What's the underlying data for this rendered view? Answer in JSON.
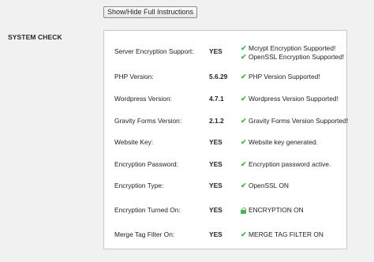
{
  "toggle_button": {
    "label": "Show/Hide Full Instructions"
  },
  "section_title": "SYSTEM CHECK",
  "colors": {
    "check": "#46b450",
    "panel_border": "#c8c8c8",
    "background": "#f1f1f1"
  },
  "rows": [
    {
      "label": "Server Encryption Support:",
      "value": "YES",
      "status": [
        {
          "icon": "check-icon",
          "text": "Mcrypt Encryption Supported!"
        },
        {
          "icon": "check-icon",
          "text": "OpenSSL Encryption Supported!"
        }
      ]
    },
    {
      "label": "PHP Version:",
      "value": "5.6.29",
      "status": [
        {
          "icon": "check-icon",
          "text": "PHP Version Supported!"
        }
      ]
    },
    {
      "label": "Wordpress Version:",
      "value": "4.7.1",
      "status": [
        {
          "icon": "check-icon",
          "text": "Wordpress Version Supported!"
        }
      ]
    },
    {
      "label": "Gravity Forms Version:",
      "value": "2.1.2",
      "status": [
        {
          "icon": "check-icon",
          "text": "Gravity Forms Version Supported!"
        }
      ]
    },
    {
      "label": "Website Key:",
      "value": "YES",
      "status": [
        {
          "icon": "check-icon",
          "text": "Website key generated."
        }
      ]
    },
    {
      "label": "Encryption Password:",
      "value": "YES",
      "status": [
        {
          "icon": "check-icon",
          "text": "Encryption password active."
        }
      ]
    },
    {
      "label": "Encryption Type:",
      "value": "YES",
      "status": [
        {
          "icon": "check-icon",
          "text": "OpenSSL ON"
        }
      ]
    },
    {
      "label": "Encryption Turned On:",
      "value": "YES",
      "status": [
        {
          "icon": "lock-icon",
          "text": "ENCRYPTION ON"
        }
      ]
    },
    {
      "label": "Merge Tag Filter On:",
      "value": "YES",
      "status": [
        {
          "icon": "check-icon",
          "text": "MERGE TAG FILTER ON"
        }
      ]
    }
  ]
}
